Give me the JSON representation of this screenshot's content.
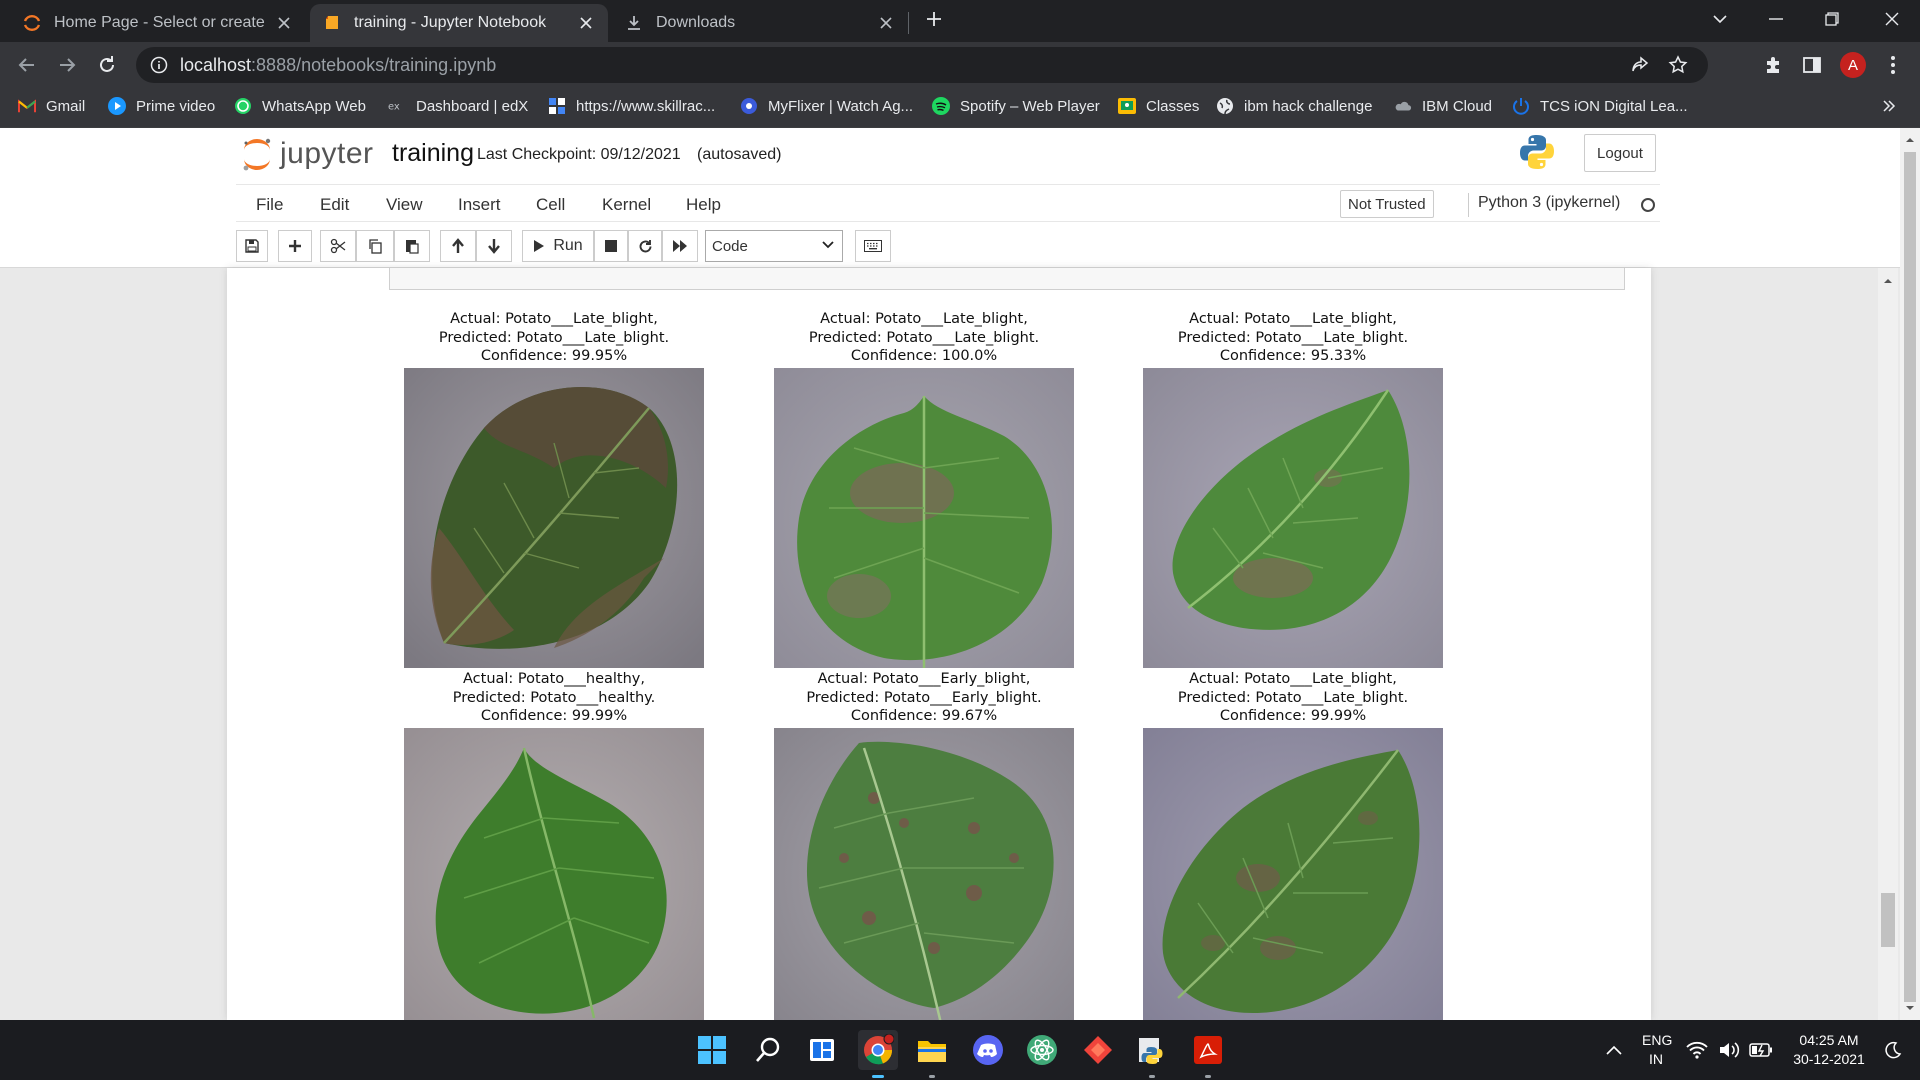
{
  "browser": {
    "tabs": [
      {
        "title": "Home Page - Select or create a n",
        "active": false
      },
      {
        "title": "training - Jupyter Notebook",
        "active": true
      },
      {
        "title": "Downloads",
        "active": false
      }
    ],
    "url_host": "localhost",
    "url_path": ":8888/notebooks/training.ipynb",
    "profile_initial": "A",
    "bookmarks": [
      "Gmail",
      "Prime video",
      "WhatsApp Web",
      "Dashboard | edX",
      "https://www.skillrac...",
      "MyFlixer | Watch Ag...",
      "Spotify – Web Player",
      "Classes",
      "ibm hack challenge",
      "IBM Cloud",
      "TCS iON Digital Lea..."
    ]
  },
  "jupyter": {
    "logo_text": "jupyter",
    "notebook_name": "training",
    "checkpoint": "Last Checkpoint: 09/12/2021",
    "autosave": "(autosaved)",
    "logout": "Logout",
    "menu": [
      "File",
      "Edit",
      "View",
      "Insert",
      "Cell",
      "Kernel",
      "Help"
    ],
    "trust": "Not Trusted",
    "kernel": "Python 3 (ipykernel)",
    "run_label": "Run",
    "cell_type": "Code"
  },
  "plots": [
    {
      "actual": "Actual: Potato___Late_blight,",
      "predicted": "Predicted: Potato___Late_blight.",
      "confidence": "Confidence: 99.95%"
    },
    {
      "actual": "Actual: Potato___Late_blight,",
      "predicted": "Predicted: Potato___Late_blight.",
      "confidence": "Confidence: 100.0%"
    },
    {
      "actual": "Actual: Potato___Late_blight,",
      "predicted": "Predicted: Potato___Late_blight.",
      "confidence": "Confidence: 95.33%"
    },
    {
      "actual": "Actual: Potato___healthy,",
      "predicted": "Predicted: Potato___healthy.",
      "confidence": "Confidence: 99.99%"
    },
    {
      "actual": "Actual: Potato___Early_blight,",
      "predicted": "Predicted: Potato___Early_blight.",
      "confidence": "Confidence: 99.67%"
    },
    {
      "actual": "Actual: Potato___Late_blight,",
      "predicted": "Predicted: Potato___Late_blight.",
      "confidence": "Confidence: 99.99%"
    }
  ],
  "taskbar": {
    "lang_top": "ENG",
    "lang_bottom": "IN",
    "time": "04:25 AM",
    "date": "30-12-2021"
  },
  "icons": {
    "tab_jupyter": "jupyter-tab-icon",
    "tab_notebook": "notebook-tab-icon",
    "tab_downloads": "download-icon",
    "python": "python-logo-icon"
  },
  "colors": {
    "jupyter_orange": "#f37726",
    "chrome_dark": "#202124",
    "toolbar_dark": "#35363a"
  }
}
